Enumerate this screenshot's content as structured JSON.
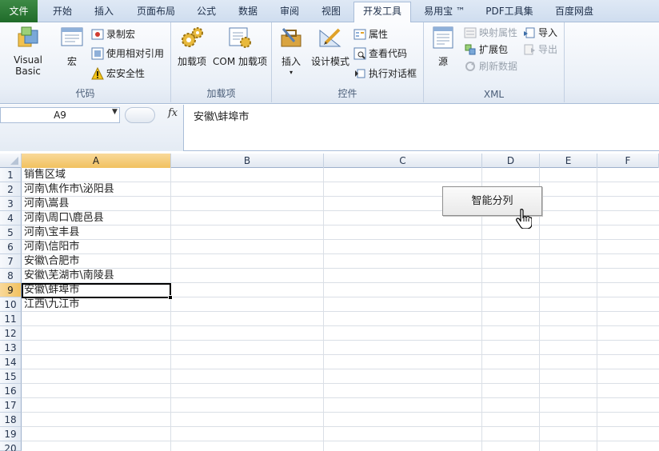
{
  "tabs": [
    {
      "label": "文件"
    },
    {
      "label": "开始"
    },
    {
      "label": "插入"
    },
    {
      "label": "页面布局"
    },
    {
      "label": "公式"
    },
    {
      "label": "数据"
    },
    {
      "label": "审阅"
    },
    {
      "label": "视图"
    },
    {
      "label": "开发工具"
    },
    {
      "label": "易用宝 ™"
    },
    {
      "label": "PDF工具集"
    },
    {
      "label": "百度网盘"
    }
  ],
  "ribbon": {
    "code": {
      "label": "代码",
      "visual_basic": "Visual Basic",
      "macros": "宏",
      "record_macro": "录制宏",
      "relative_ref": "使用相对引用",
      "macro_security": "宏安全性"
    },
    "addins": {
      "label": "加载项",
      "addins": "加载项",
      "com_addins": "COM 加载项"
    },
    "controls": {
      "label": "控件",
      "insert": "插入",
      "design_mode": "设计模式",
      "properties": "属性",
      "view_code": "查看代码",
      "run_dialog": "执行对话框"
    },
    "xml": {
      "label": "XML",
      "source": "源",
      "map_properties": "映射属性",
      "expansion_packs": "扩展包",
      "refresh_data": "刷新数据",
      "import": "导入",
      "export": "导出"
    }
  },
  "formula_bar": {
    "name_box": "A9",
    "fx": "fx",
    "content": "安徽\\蚌埠市"
  },
  "columns": [
    "A",
    "B",
    "C",
    "D",
    "E",
    "F"
  ],
  "rows": [
    "1",
    "2",
    "3",
    "4",
    "5",
    "6",
    "7",
    "8",
    "9",
    "10",
    "11",
    "12",
    "13",
    "14",
    "15",
    "16",
    "17",
    "18",
    "19",
    "20"
  ],
  "cells": {
    "A": [
      "销售区域",
      "河南\\焦作市\\泌阳县",
      "河南\\嵩县",
      "河南\\周口\\鹿邑县",
      "河南\\宝丰县",
      "河南\\信阳市",
      "安徽\\合肥市",
      "安徽\\芜湖市\\南陵县",
      "安徽\\蚌埠市",
      "江西\\九江市"
    ]
  },
  "form_button": {
    "label": "智能分列"
  },
  "colors": {
    "file_tab": "#1f6b2a",
    "selection_header": "#f1c15f",
    "ribbon_bg": "#e9eff7"
  }
}
